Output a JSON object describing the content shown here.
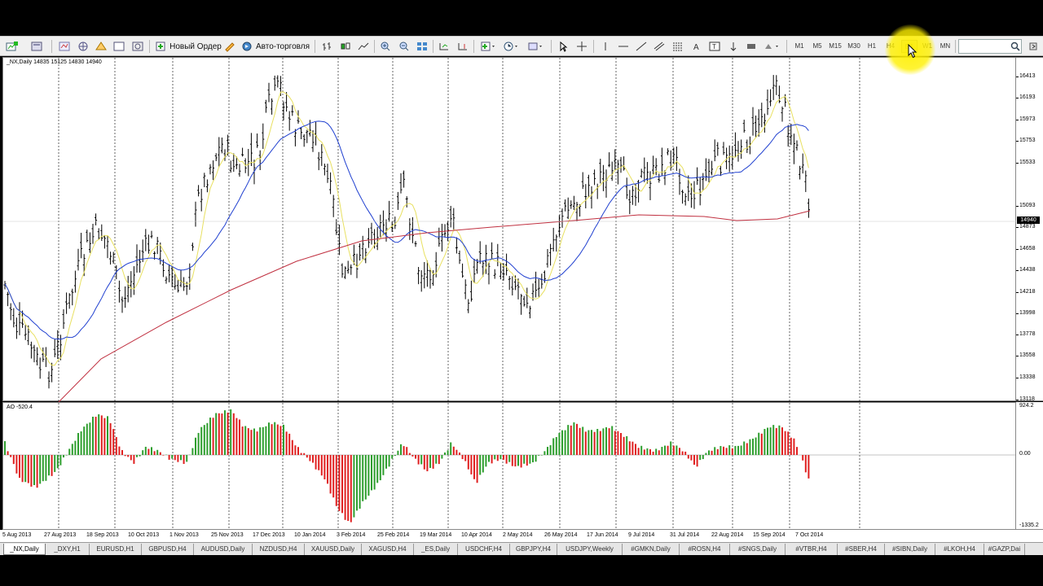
{
  "toolbar": {
    "new_order_label": "Новый Ордер",
    "auto_trading_label": "Авто-торговля",
    "timeframes": [
      "M1",
      "M5",
      "M15",
      "M30",
      "H1",
      "H4",
      "D1",
      "W1",
      "MN"
    ],
    "active_timeframe": "D1"
  },
  "chart": {
    "header": "_NX,Daily  14835 15125 14830 14940",
    "last_price": "14940",
    "price_labels": [
      "16413",
      "16193",
      "15973",
      "15753",
      "15533",
      "15093",
      "14873",
      "14658",
      "14438",
      "14218",
      "13998",
      "13778",
      "13558",
      "13338",
      "13118"
    ],
    "date_labels": [
      "5 Aug 2013",
      "27 Aug 2013",
      "18 Sep 2013",
      "10 Oct 2013",
      "1 Nov 2013",
      "25 Nov 2013",
      "17 Dec 2013",
      "10 Jan 2014",
      "3 Feb 2014",
      "25 Feb 2014",
      "19 Mar 2014",
      "10 Apr 2014",
      "2 May 2014",
      "26 May 2014",
      "17 Jun 2014",
      "9 Jul 2014",
      "31 Jul 2014",
      "22 Aug 2014",
      "15 Sep 2014",
      "7 Oct 2014"
    ]
  },
  "indicator": {
    "header": "AO -520.4",
    "scale_labels": [
      "924.2",
      "0.00",
      "-1335.2"
    ]
  },
  "tabs": [
    "_NX,Daily",
    "_DXY,H1",
    "EURUSD,H1",
    "GBPUSD,H4",
    "AUDUSD,Daily",
    "NZDUSD,H4",
    "XAUUSD,Daily",
    "XAGUSD,H4",
    "_ES,Daily",
    "USDCHF,H4",
    "GBPJPY,H4",
    "USDJPY,Weekly",
    "#GMKN,Daily",
    "#ROSN,H4",
    "#SNGS,Daily",
    "#VTBR,H4",
    "#SBER,H4",
    "#SIBN,Daily",
    "#LKOH,H4",
    "#GAZP,Dai"
  ],
  "active_tab": "_NX,Daily",
  "colors": {
    "bull_bar": "#2e9e2e",
    "bear_bar": "#e02020",
    "ma_fast": "#e8e060",
    "ma_mid": "#2040d0",
    "ma_slow": "#c03040",
    "highlight": "#ffee00"
  }
}
